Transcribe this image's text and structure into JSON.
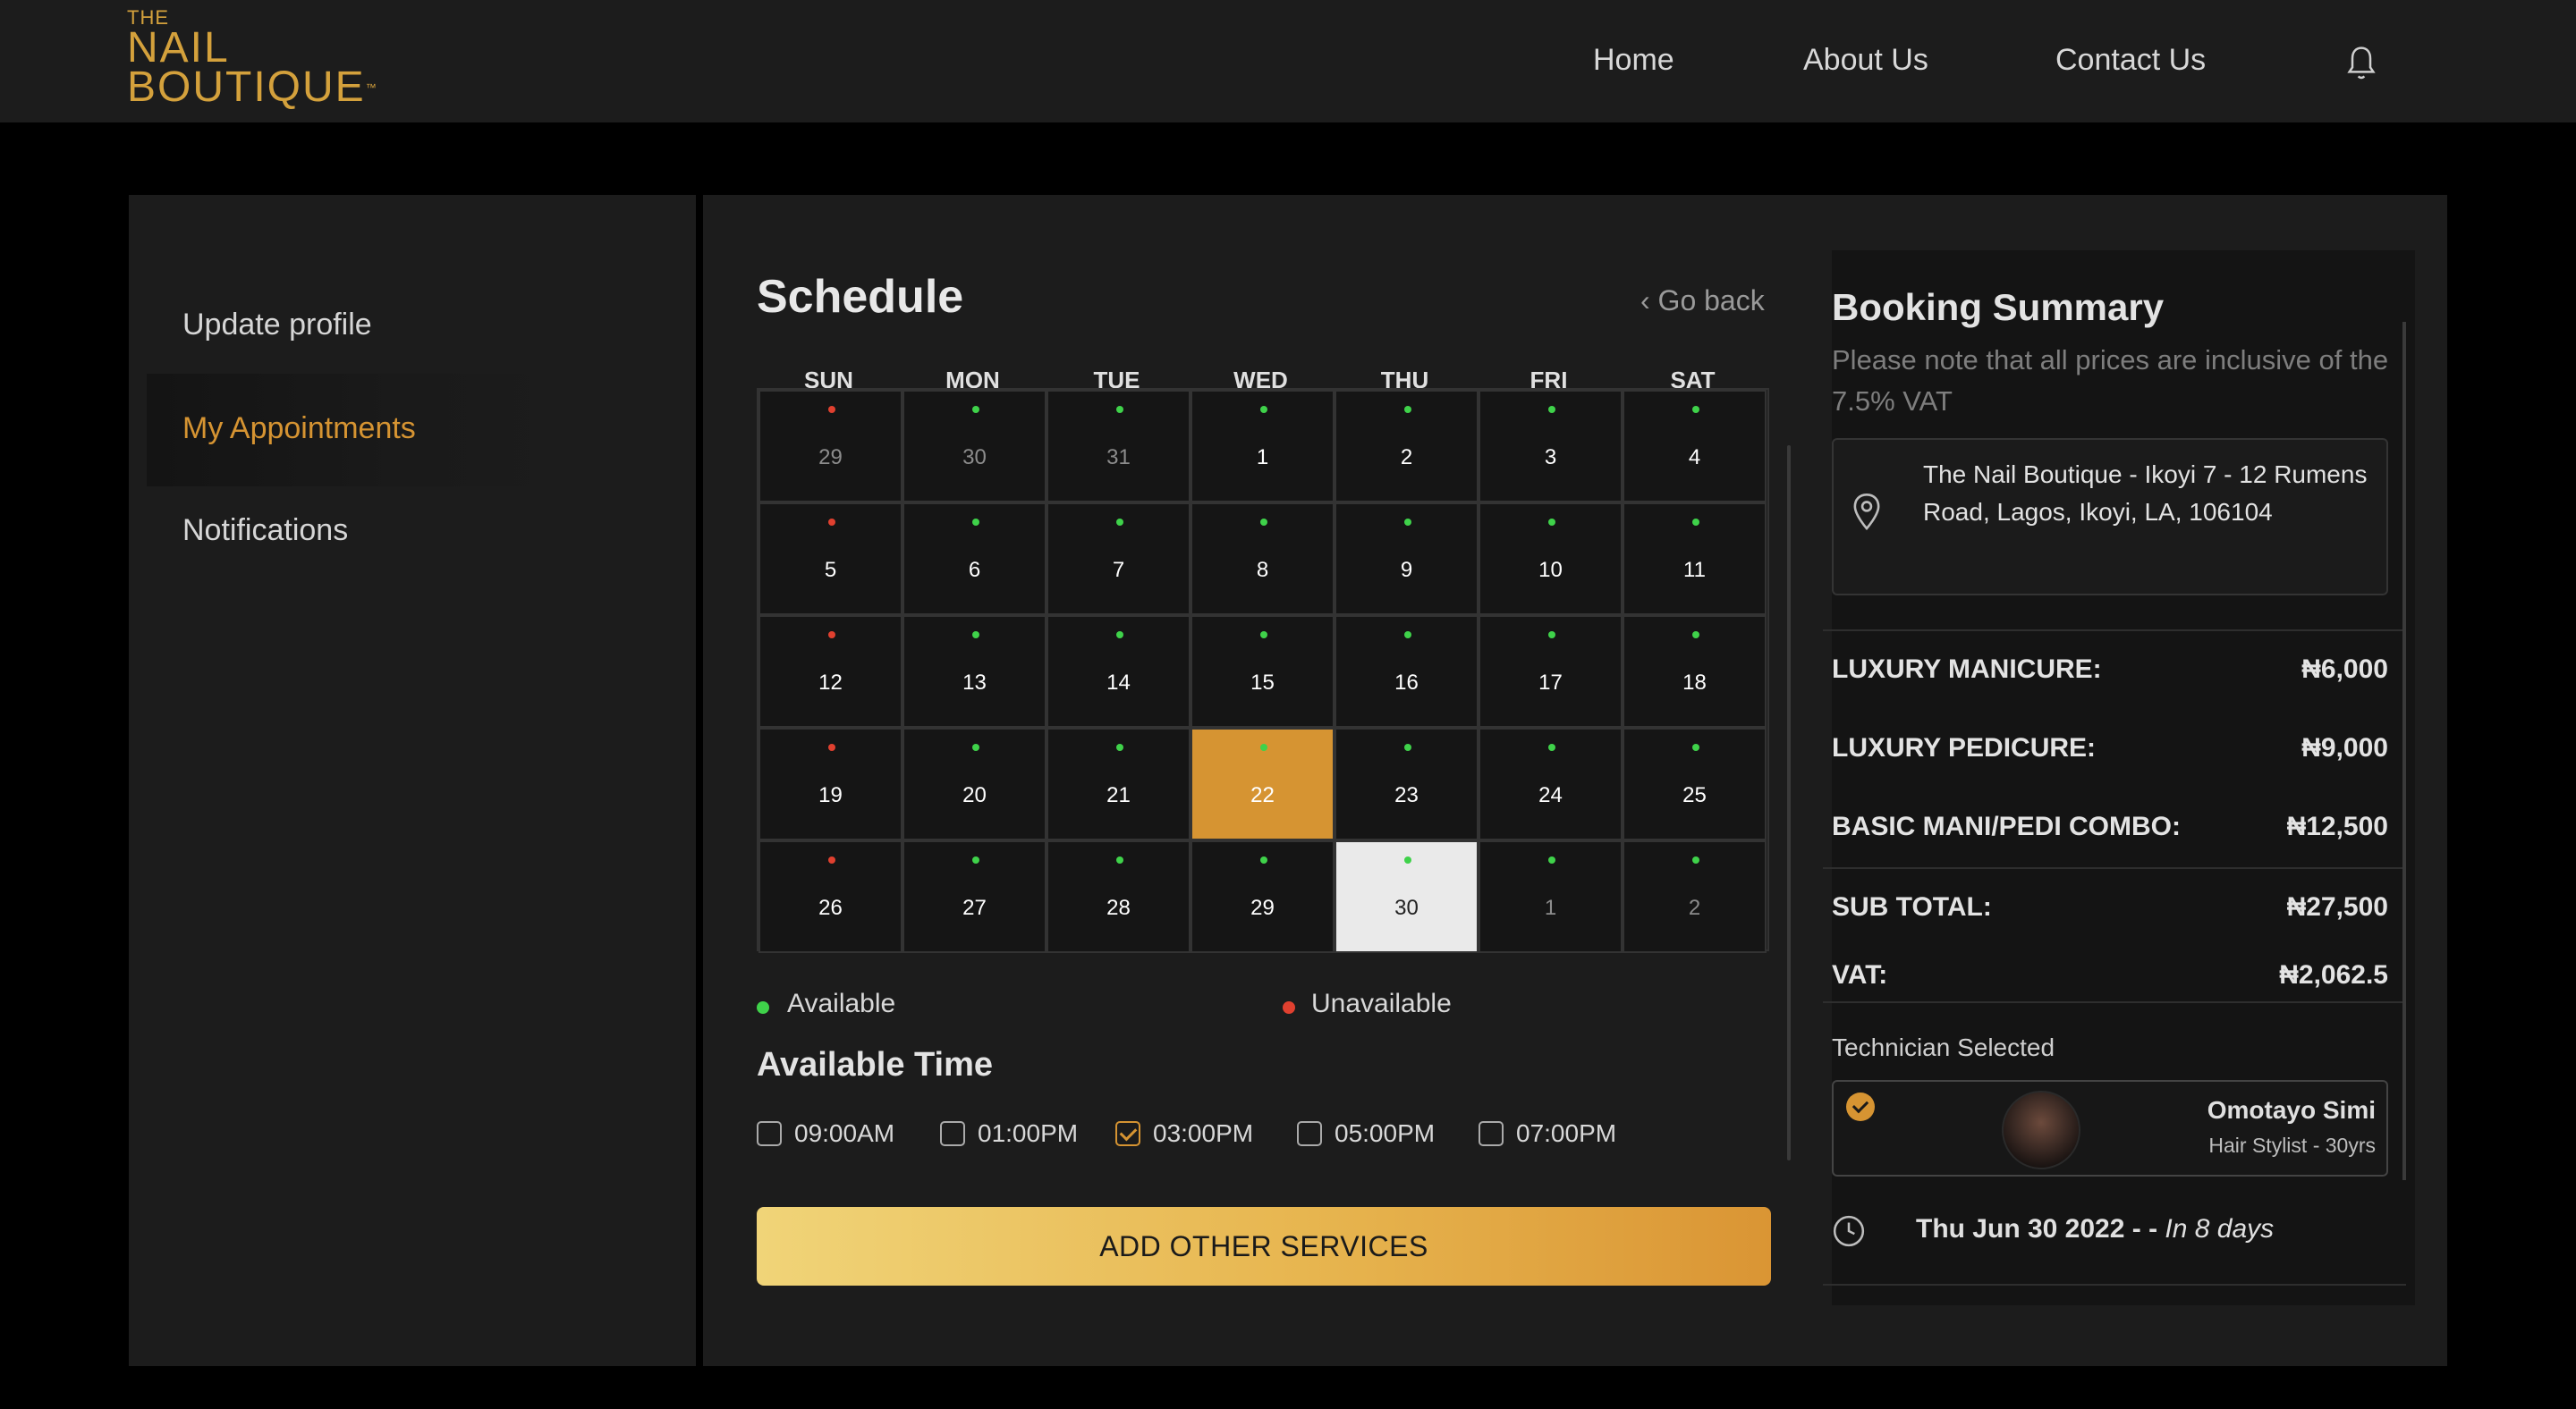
{
  "brand": {
    "the": "THE",
    "line1": "NAIL",
    "line2": "BOUTIQUE",
    "tm": "™"
  },
  "nav": {
    "home": "Home",
    "about": "About Us",
    "contact": "Contact Us"
  },
  "sidebar": {
    "items": [
      {
        "label": "Update profile"
      },
      {
        "label": "My Appointments"
      },
      {
        "label": "Notifications"
      }
    ],
    "active_color": "#d69432"
  },
  "schedule": {
    "title": "Schedule",
    "go_back": "‹ Go back",
    "days_of_week": [
      "SUN",
      "MON",
      "TUE",
      "WED",
      "THU",
      "FRI",
      "SAT"
    ],
    "weeks": [
      [
        {
          "d": "29",
          "m": true,
          "s": "u"
        },
        {
          "d": "30",
          "m": true,
          "s": "a"
        },
        {
          "d": "31",
          "m": true,
          "s": "a"
        },
        {
          "d": "1",
          "s": "a"
        },
        {
          "d": "2",
          "s": "a"
        },
        {
          "d": "3",
          "s": "a"
        },
        {
          "d": "4",
          "s": "a"
        }
      ],
      [
        {
          "d": "5",
          "s": "u"
        },
        {
          "d": "6",
          "s": "a"
        },
        {
          "d": "7",
          "s": "a"
        },
        {
          "d": "8",
          "s": "a"
        },
        {
          "d": "9",
          "s": "a"
        },
        {
          "d": "10",
          "s": "a"
        },
        {
          "d": "11",
          "s": "a"
        }
      ],
      [
        {
          "d": "12",
          "s": "u"
        },
        {
          "d": "13",
          "s": "a"
        },
        {
          "d": "14",
          "s": "a"
        },
        {
          "d": "15",
          "s": "a"
        },
        {
          "d": "16",
          "s": "a"
        },
        {
          "d": "17",
          "s": "a"
        },
        {
          "d": "18",
          "s": "a"
        }
      ],
      [
        {
          "d": "19",
          "s": "u"
        },
        {
          "d": "20",
          "s": "a"
        },
        {
          "d": "21",
          "s": "a"
        },
        {
          "d": "22",
          "s": "a",
          "sel": true
        },
        {
          "d": "23",
          "s": "a"
        },
        {
          "d": "24",
          "s": "a"
        },
        {
          "d": "25",
          "s": "a"
        }
      ],
      [
        {
          "d": "26",
          "s": "u"
        },
        {
          "d": "27",
          "s": "a"
        },
        {
          "d": "28",
          "s": "a"
        },
        {
          "d": "29",
          "s": "a"
        },
        {
          "d": "30",
          "s": "a",
          "today": true
        },
        {
          "d": "1",
          "m": true,
          "s": "a"
        },
        {
          "d": "2",
          "m": true,
          "s": "a"
        }
      ]
    ],
    "legend": {
      "available": "Available",
      "unavailable": "Unavailable"
    },
    "colors": {
      "available": "#3fd24a",
      "unavailable": "#e0402f",
      "selected": "#d69432",
      "today": "#eaeaea"
    },
    "available_time_title": "Available Time",
    "time_slots": [
      {
        "label": "09:00AM",
        "checked": false
      },
      {
        "label": "01:00PM",
        "checked": false
      },
      {
        "label": "03:00PM",
        "checked": true
      },
      {
        "label": "05:00PM",
        "checked": false
      },
      {
        "label": "07:00PM",
        "checked": false
      }
    ],
    "add_button": "ADD OTHER SERVICES"
  },
  "summary": {
    "title": "Booking Summary",
    "note": "Please note that all prices are inclusive of the 7.5% VAT",
    "location": "The Nail Boutique - Ikoyi 7 - 12 Rumens Road, Lagos, Ikoyi, LA, 106104",
    "services": [
      {
        "name": "LUXURY MANICURE:",
        "price": "₦6,000"
      },
      {
        "name": "LUXURY PEDICURE:",
        "price": "₦9,000"
      },
      {
        "name": "BASIC MANI/PEDI COMBO:",
        "price": "₦12,500"
      }
    ],
    "subtotal": {
      "label": "SUB TOTAL:",
      "value": "₦27,500"
    },
    "vat": {
      "label": "VAT:",
      "value": "₦2,062.5"
    },
    "technician_label": "Technician Selected",
    "technician": {
      "name": "Omotayo Simi",
      "role": "Hair Stylist - 30yrs"
    },
    "date": "Thu Jun 30 2022 - -",
    "relative": "In 8 days"
  }
}
